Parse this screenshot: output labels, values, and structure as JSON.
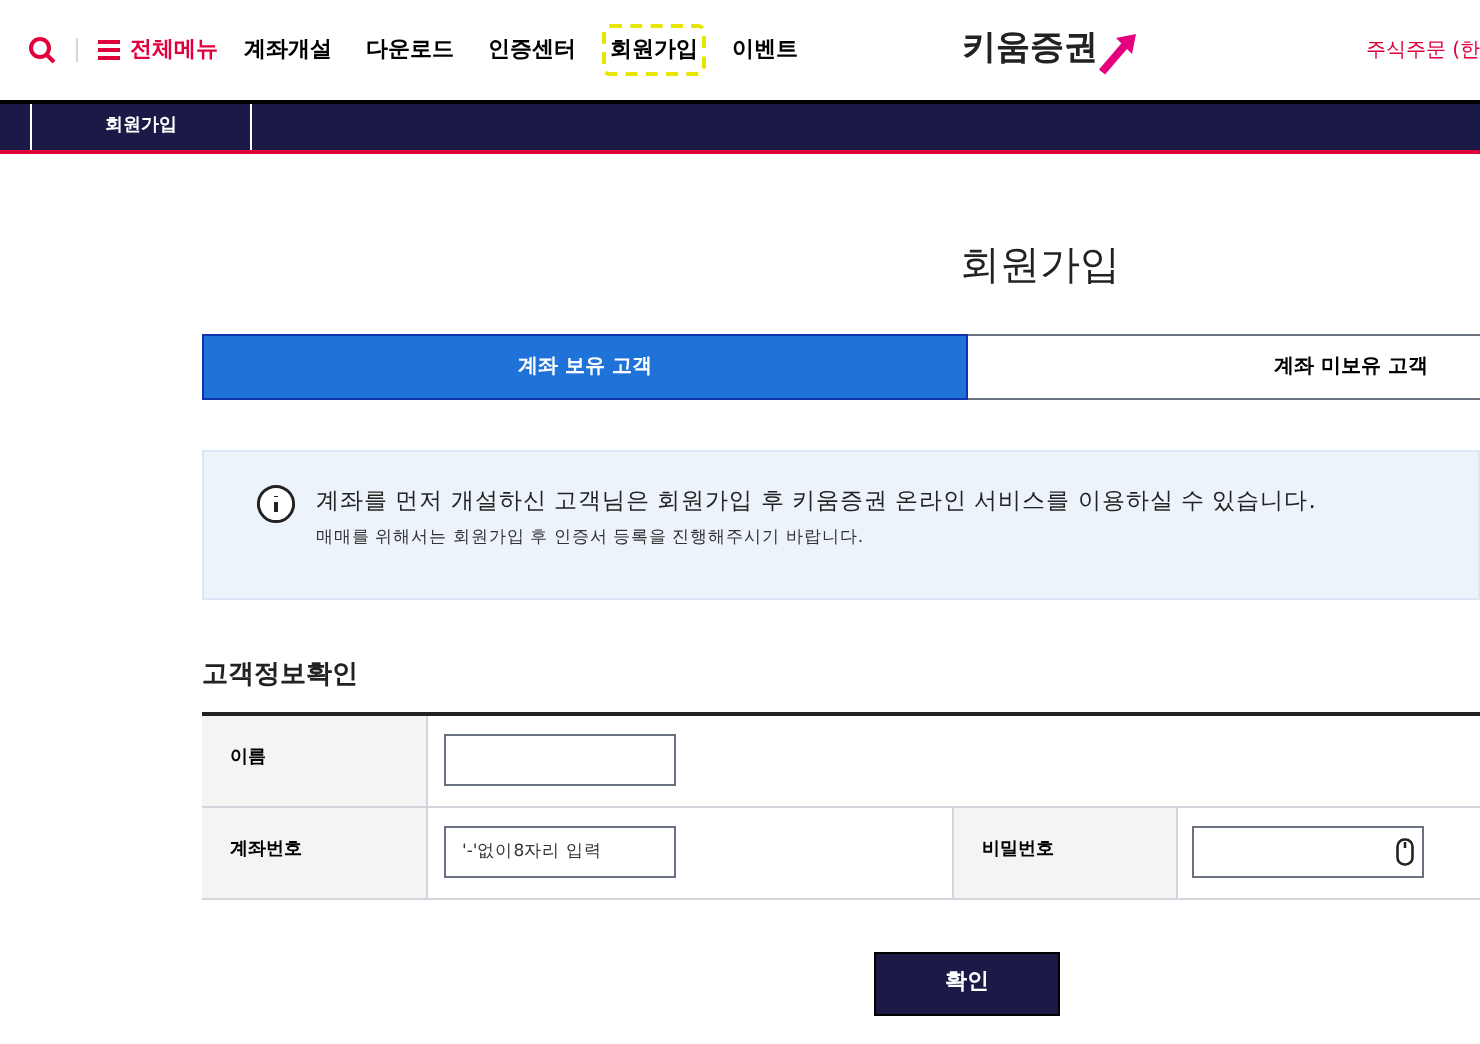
{
  "header": {
    "menu_label": "전체메뉴",
    "nav": [
      {
        "label": "계좌개설",
        "highlighted": false
      },
      {
        "label": "다운로드",
        "highlighted": false
      },
      {
        "label": "인증센터",
        "highlighted": false
      },
      {
        "label": "회원가입",
        "highlighted": true
      },
      {
        "label": "이벤트",
        "highlighted": false
      }
    ],
    "logo": "키움증권",
    "right_link": "주식주문 (한"
  },
  "breadcrumb": {
    "item": "회원가입"
  },
  "page_title": "회원가입",
  "tabs": [
    {
      "label": "계좌 보유 고객",
      "selected": true
    },
    {
      "label": "계좌 미보유 고객",
      "selected": false
    }
  ],
  "notice": {
    "main": "계좌를 먼저 개설하신 고객님은 회원가입 후 키움증권 온라인 서비스를 이용하실 수 있습니다.",
    "sub": "매매를 위해서는 회원가입 후 인증서 등록을 진행해주시기 바랍니다."
  },
  "form": {
    "title": "고객정보확인",
    "name_label": "이름",
    "account_label": "계좌번호",
    "account_placeholder": "'-'없이8자리 입력",
    "password_label": "비밀번호"
  },
  "buttons": [
    "확인"
  ]
}
